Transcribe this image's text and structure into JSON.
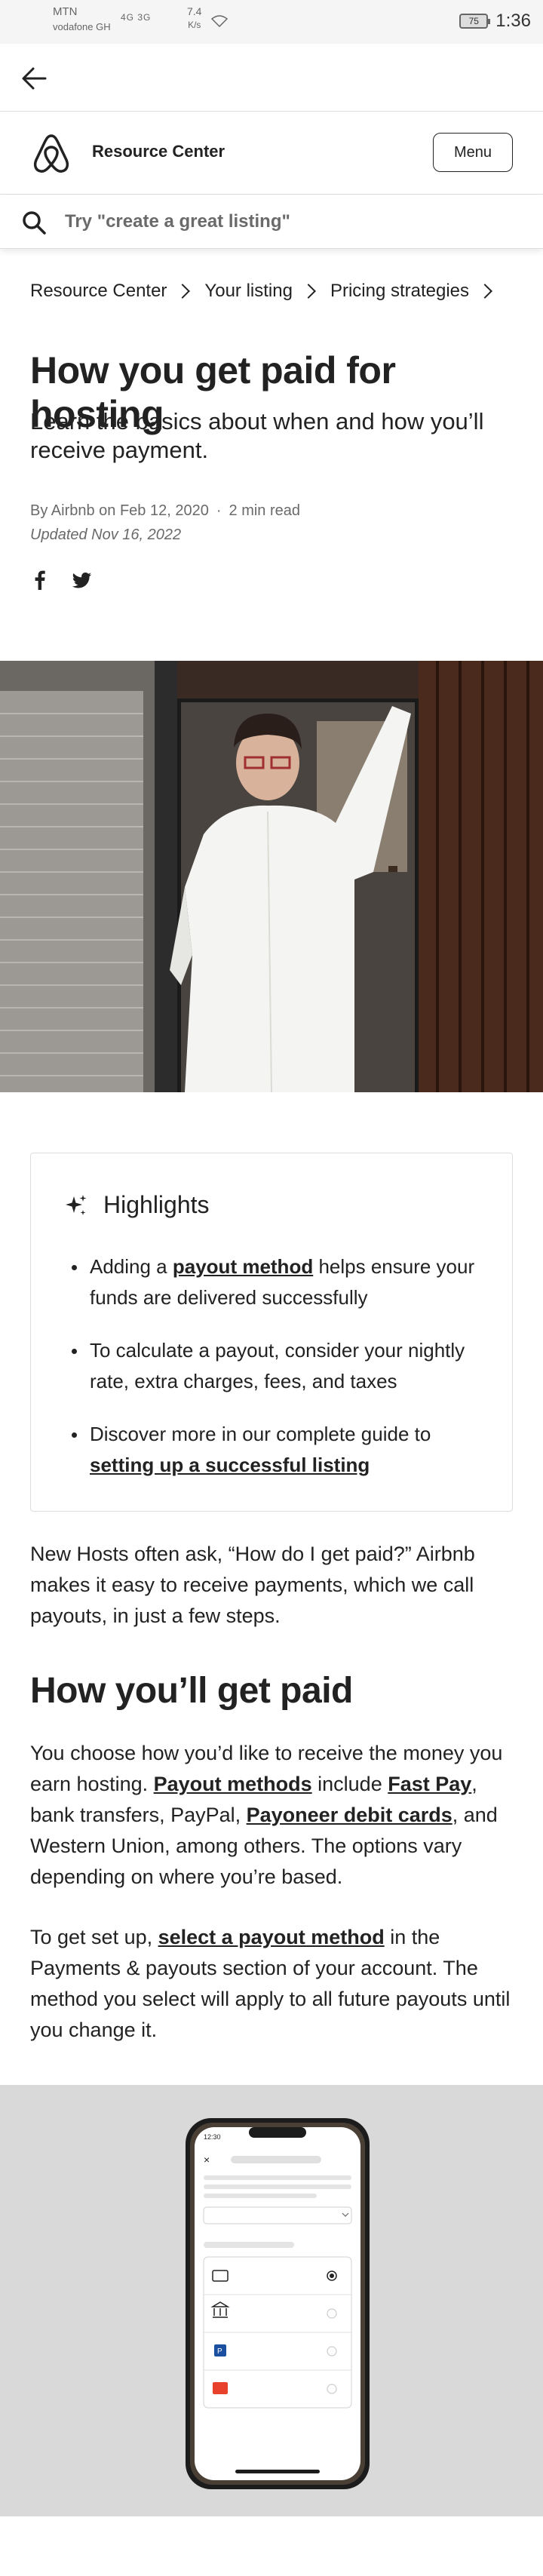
{
  "status_bar": {
    "carrier1": "MTN",
    "carrier2": "vodafone GH",
    "signal": "4G 3G",
    "speed_value": "7.4",
    "speed_unit": "K/s",
    "battery": "75",
    "time": "1:36"
  },
  "header": {
    "site_title": "Resource Center",
    "menu_label": "Menu"
  },
  "search": {
    "placeholder": "Try \"create a great listing\""
  },
  "breadcrumb": [
    "Resource Center",
    "Your listing",
    "Pricing strategies"
  ],
  "article": {
    "title": "How you get paid for hosting",
    "subtitle": "Learn the basics about when and how you’ll receive payment.",
    "author": "By Airbnb on Feb 12, 2020",
    "separator": "·",
    "read_time": "2 min read",
    "updated": "Updated Nov 16, 2022"
  },
  "highlights": {
    "title": "Highlights",
    "item1_pre": "Adding a ",
    "item1_link": "payout method",
    "item1_post": " helps ensure your funds are delivered successfully",
    "item2": "To calculate a payout, consider your nightly rate, extra charges, fees, and taxes",
    "item3_pre": "Discover more in our complete guide to ",
    "item3_link": "setting up a successful listing"
  },
  "intro": "New Hosts often ask, “How do I get paid?” Airbnb makes it easy to receive payments, which we call payouts, in just a few steps.",
  "section": {
    "heading": "How you’ll get paid",
    "p1_a": "You choose how you’d like to receive the money you earn hosting. ",
    "p1_link1": "Payout methods",
    "p1_b": " include ",
    "p1_link2": "Fast Pay",
    "p1_c": ", bank transfers, PayPal, ",
    "p1_link3": "Payoneer debit cards",
    "p1_d": ", and Western Union, among others. The options vary depending on where you’re based.",
    "p2_a": "To get set up, ",
    "p2_link": "select a payout method",
    "p2_b": " in the Payments & payouts section of your account. The method you select will apply to all future payouts until you change it."
  },
  "phone_mock": {
    "time": "12:30"
  },
  "colors": {
    "brand": "#FF385C",
    "text": "#222222",
    "muted": "#6a6a6a",
    "border": "#dddddd",
    "phone_bg": "#d9d9d9"
  }
}
